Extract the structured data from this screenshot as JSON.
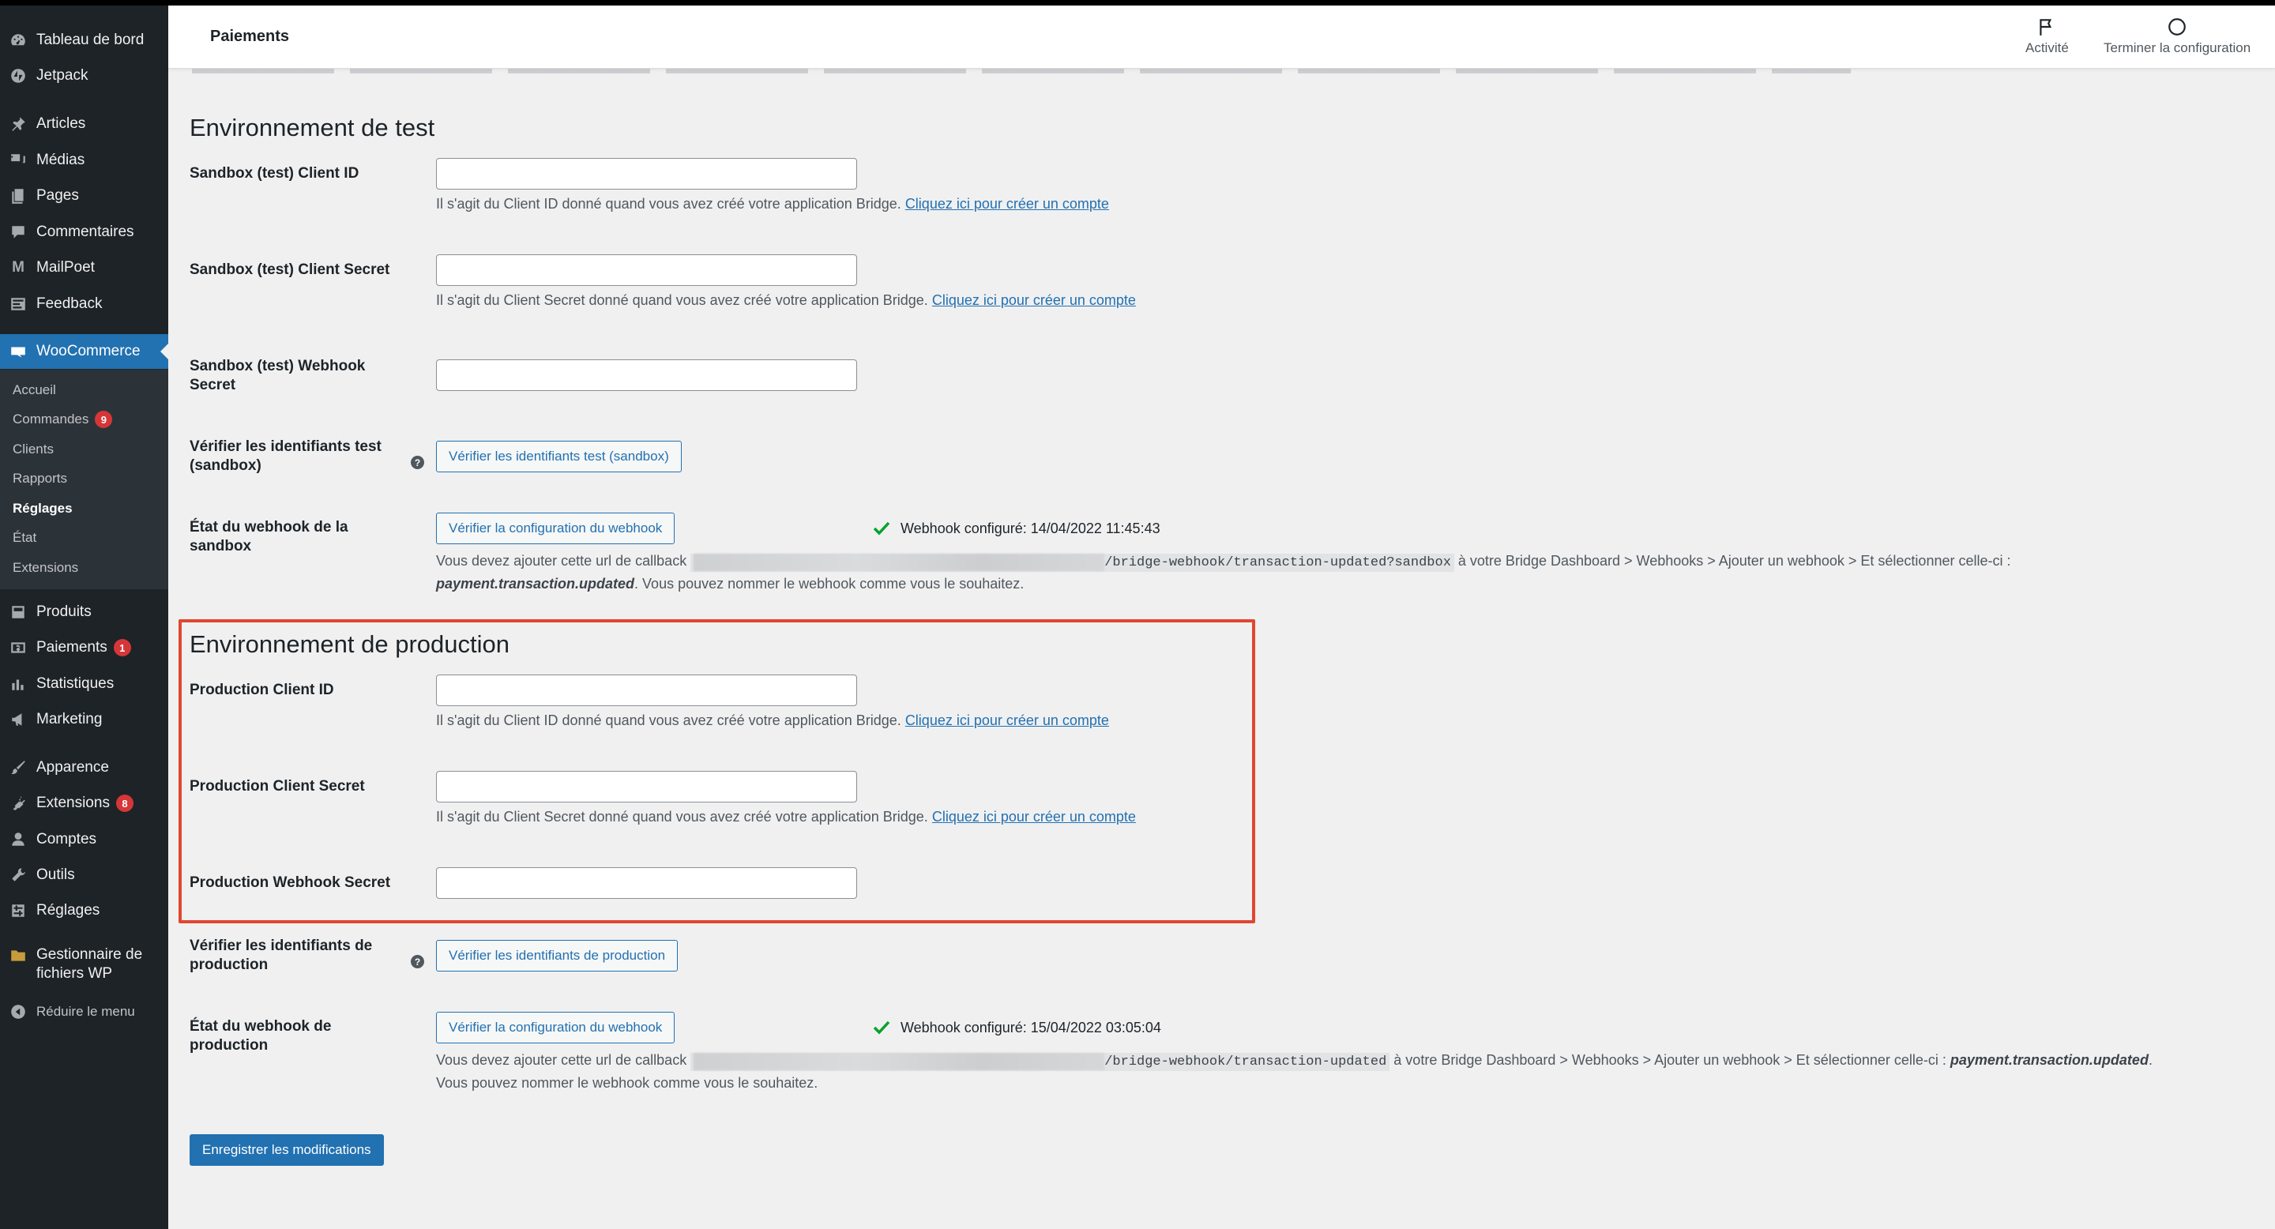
{
  "sidebar": {
    "items": [
      {
        "label": "Tableau de bord",
        "icon": "dashboard-icon"
      },
      {
        "label": "Jetpack",
        "icon": "jetpack-icon"
      },
      {
        "label": "Articles",
        "icon": "pin-icon"
      },
      {
        "label": "Médias",
        "icon": "media-icon"
      },
      {
        "label": "Pages",
        "icon": "pages-icon"
      },
      {
        "label": "Commentaires",
        "icon": "comments-icon"
      },
      {
        "label": "MailPoet",
        "icon": "mailpoet-icon"
      },
      {
        "label": "Feedback",
        "icon": "feedback-icon"
      },
      {
        "label": "WooCommerce",
        "icon": "woocommerce-icon"
      },
      {
        "label": "Produits",
        "icon": "products-icon"
      },
      {
        "label": "Paiements",
        "icon": "payments-icon",
        "badge": "1"
      },
      {
        "label": "Statistiques",
        "icon": "stats-icon"
      },
      {
        "label": "Marketing",
        "icon": "megaphone-icon"
      },
      {
        "label": "Apparence",
        "icon": "brush-icon"
      },
      {
        "label": "Extensions",
        "icon": "plugin-icon",
        "badge": "8"
      },
      {
        "label": "Comptes",
        "icon": "user-icon"
      },
      {
        "label": "Outils",
        "icon": "wrench-icon"
      },
      {
        "label": "Réglages",
        "icon": "settings-icon"
      },
      {
        "label": "Gestionnaire de fichiers WP",
        "icon": "folder-icon"
      },
      {
        "label": "Réduire le menu",
        "icon": "collapse-icon"
      }
    ],
    "woo_submenu": [
      {
        "label": "Accueil"
      },
      {
        "label": "Commandes",
        "badge": "9"
      },
      {
        "label": "Clients"
      },
      {
        "label": "Rapports"
      },
      {
        "label": "Réglages"
      },
      {
        "label": "État"
      },
      {
        "label": "Extensions"
      }
    ]
  },
  "topbar": {
    "title": "Paiements",
    "activity_label": "Activité",
    "finish_setup_label": "Terminer la configuration"
  },
  "test_env": {
    "title": "Environnement de test",
    "client_id_label": "Sandbox (test) Client ID",
    "client_id_value": "",
    "client_id_desc": "Il s'agit du Client ID donné quand vous avez créé votre application Bridge.",
    "create_account_link": "Cliquez ici pour créer un compte",
    "client_secret_label": "Sandbox (test) Client Secret",
    "client_secret_value": "",
    "client_secret_desc": "Il s'agit du Client Secret donné quand vous avez créé votre application Bridge.",
    "webhook_secret_label": "Sandbox (test) Webhook Secret",
    "webhook_secret_value": "",
    "verify_label": "Vérifier les identifiants test (sandbox)",
    "verify_button": "Vérifier les identifiants test (sandbox)",
    "webhook_state_label": "État du webhook de la sandbox",
    "webhook_button": "Vérifier la configuration du webhook",
    "webhook_status": "Webhook configuré: 14/04/2022 11:45:43",
    "callback_prefix": "Vous devez ajouter cette url de callback",
    "callback_url": "/bridge-webhook/transaction-updated?sandbox",
    "callback_suffix": "à votre Bridge Dashboard > Webhooks > Ajouter un webhook > Et sélectionner celle-ci :",
    "event_name": "payment.transaction.updated",
    "rename_note": ". Vous pouvez nommer le webhook comme vous le souhaitez."
  },
  "prod_env": {
    "title": "Environnement de production",
    "client_id_label": "Production Client ID",
    "client_id_value": "",
    "client_id_desc": "Il s'agit du Client ID donné quand vous avez créé votre application Bridge.",
    "create_account_link": "Cliquez ici pour créer un compte",
    "client_secret_label": "Production Client Secret",
    "client_secret_value": "",
    "client_secret_desc": "Il s'agit du Client Secret donné quand vous avez créé votre application Bridge.",
    "webhook_secret_label": "Production Webhook Secret",
    "webhook_secret_value": "",
    "verify_label": "Vérifier les identifiants de production",
    "verify_button": "Vérifier les identifiants de production",
    "webhook_state_label": "État du webhook de production",
    "webhook_button": "Vérifier la configuration du webhook",
    "webhook_status": "Webhook configuré: 15/04/2022 03:05:04",
    "callback_prefix": "Vous devez ajouter cette url de callback",
    "callback_url": "/bridge-webhook/transaction-updated",
    "callback_suffix": "à votre Bridge Dashboard > Webhooks > Ajouter un webhook > Et sélectionner celle-ci :",
    "event_name": "payment.transaction.updated",
    "rename_note": "Vous pouvez nommer le webhook comme vous le souhaitez."
  },
  "save_button": "Enregistrer les modifications",
  "colors": {
    "sidebar_bg": "#1d2327",
    "accent": "#2271b1",
    "badge": "#d63638",
    "success": "#00a32a",
    "highlight": "#e1462f"
  }
}
